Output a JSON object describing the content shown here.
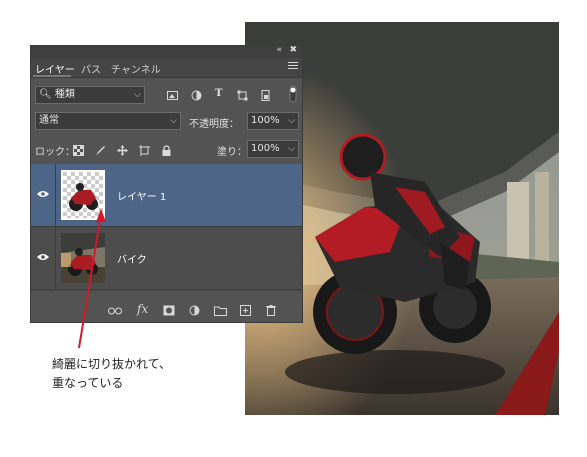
{
  "panel": {
    "tabs": [
      "レイヤー",
      "パス",
      "チャンネル"
    ],
    "filter_kind": "種類",
    "blend_mode": "通常",
    "opacity_label": "不透明度：",
    "opacity_value": "100%",
    "lock_label": "ロック：",
    "fill_label": "塗り：",
    "fill_value": "100%",
    "layers": [
      {
        "name": "レイヤー 1",
        "selected": true
      },
      {
        "name": "バイク",
        "selected": false
      }
    ],
    "bottom_icons": [
      "link-icon",
      "fx-icon",
      "mask-icon",
      "adjustment-icon",
      "folder-icon",
      "new-layer-icon",
      "trash-icon"
    ],
    "fx_label": "fx"
  },
  "annotation": {
    "line1": "綺麗に切り抜かれて、",
    "line2": "重なっている",
    "color": "#d0192b"
  },
  "colors": {
    "panel_bg": "#535353",
    "selected_layer": "#4d6587"
  }
}
